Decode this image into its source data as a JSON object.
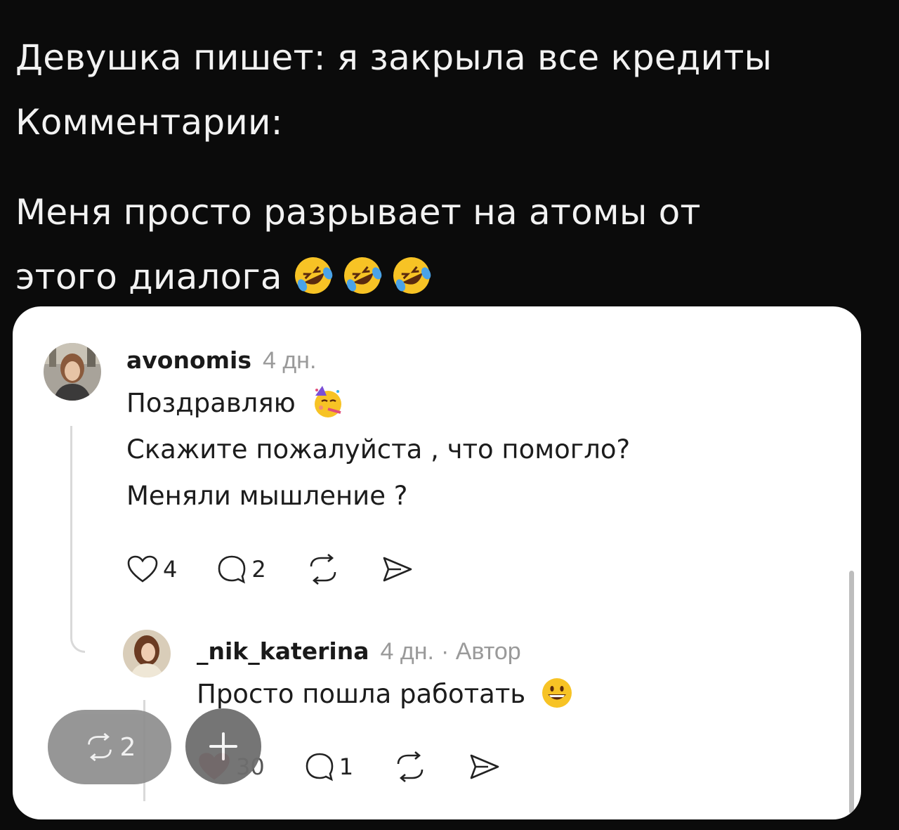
{
  "headline": {
    "line1": "Девушка пишет: я закрыла все кредиты",
    "line2": "Комментарии:",
    "line3": "Меня просто разрывает на атомы от",
    "line4": "этого диалога",
    "emoji": "rolling-on-the-floor-laughing"
  },
  "comment1": {
    "username": "avonomis",
    "time": "4 дн.",
    "lines": [
      "Поздравляю",
      "Скажите пожалуйста , что помогло?",
      "Меняли мышление ?"
    ],
    "emoji": "partying-face",
    "likes": "4",
    "replies": "2"
  },
  "comment2": {
    "username": "_nik_katerina",
    "time": "4 дн.",
    "author_label": "· Автор",
    "text": "Просто пошла работать",
    "emoji": "grinning-face",
    "likes": "30",
    "replies": "1"
  },
  "floating": {
    "reposts": "2",
    "plus_icon": "plus-icon"
  },
  "colors": {
    "background": "#0b0b0b",
    "card": "#ffffff",
    "like_red": "#c8102e",
    "muted": "#9a9a9a"
  }
}
